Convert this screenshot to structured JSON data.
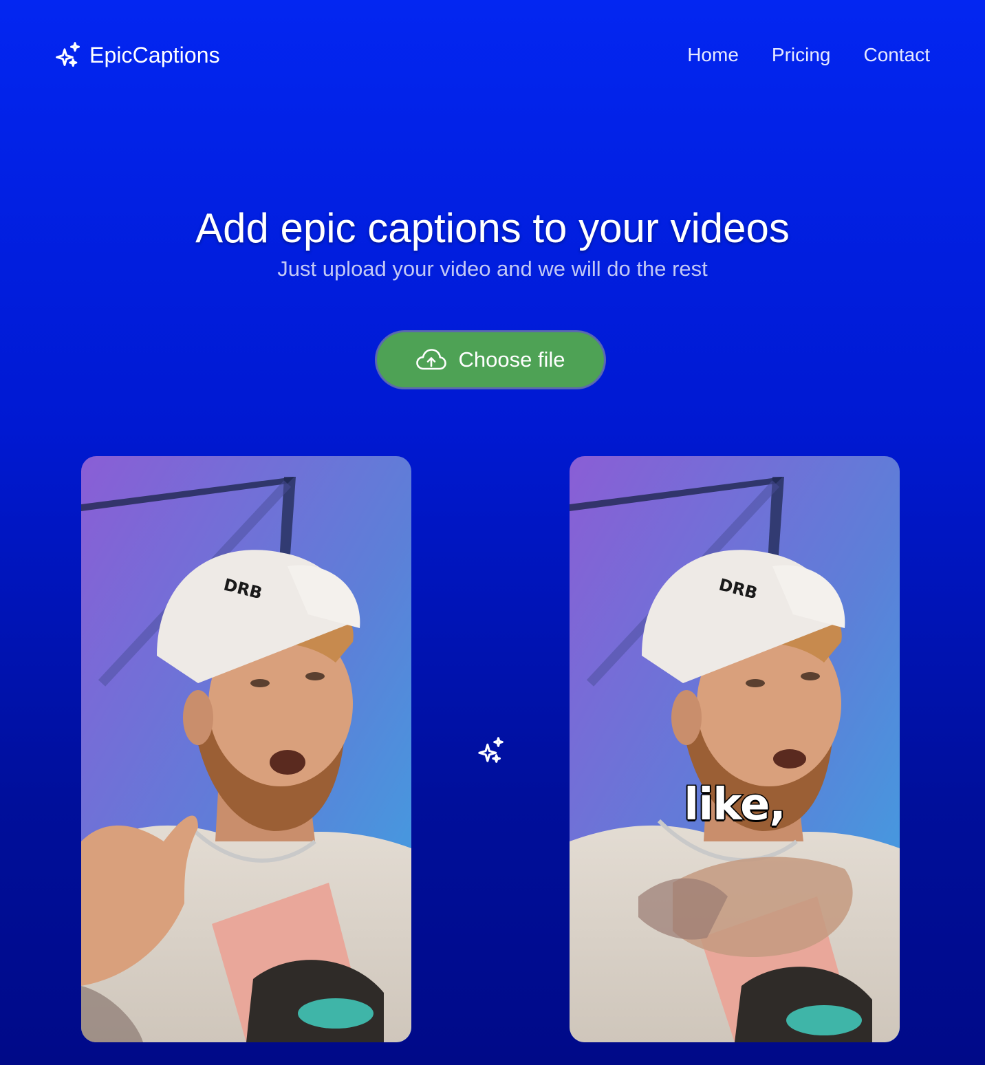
{
  "brand": {
    "name": "EpicCaptions",
    "icon": "sparkles-icon"
  },
  "nav": {
    "links": [
      {
        "label": "Home"
      },
      {
        "label": "Pricing"
      },
      {
        "label": "Contact"
      }
    ]
  },
  "hero": {
    "title": "Add epic captions to your videos",
    "subtitle": "Just upload your video and we will do the rest"
  },
  "upload": {
    "label": "Choose file",
    "icon": "cloud-upload-icon",
    "color": "#4ea255"
  },
  "preview": {
    "left_video": "video-original",
    "right_video": "video-captioned",
    "caption": "like,",
    "divider_icon": "sparkles-icon"
  },
  "colors": {
    "background_top": "#0326f1",
    "background_bottom": "#000a88",
    "button": "#4ea255"
  }
}
